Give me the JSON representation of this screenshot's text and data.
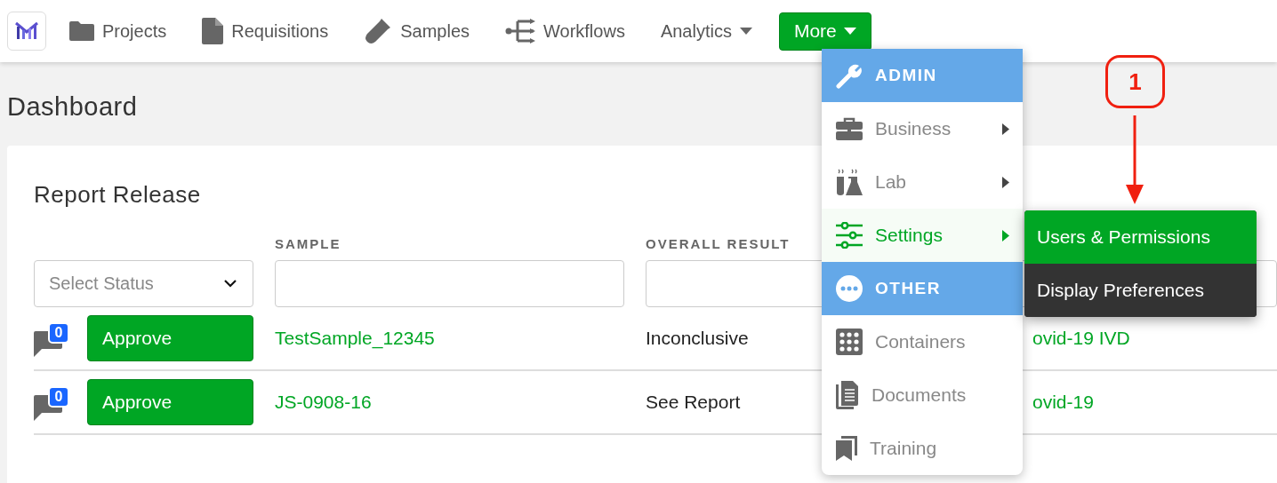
{
  "nav": {
    "items": [
      {
        "label": "Projects",
        "dropdown": false,
        "selected": false
      },
      {
        "label": "Requisitions",
        "dropdown": false,
        "selected": false
      },
      {
        "label": "Samples",
        "dropdown": false,
        "selected": false
      },
      {
        "label": "Workflows",
        "dropdown": false,
        "selected": false
      },
      {
        "label": "Analytics",
        "dropdown": true,
        "selected": false
      },
      {
        "label": "More",
        "dropdown": true,
        "selected": true
      }
    ]
  },
  "page_title": "Dashboard",
  "card": {
    "title": "Report Release",
    "columns": [
      "SAMPLE",
      "OVERALL RESULT"
    ],
    "status_filter": {
      "placeholder": "Select Status"
    },
    "rows": [
      {
        "comments": "0",
        "action": "Approve",
        "sample": "TestSample_12345",
        "result": "Inconclusive",
        "column_5": "ovid-19 IVD"
      },
      {
        "comments": "0",
        "action": "Approve",
        "sample": "JS-0908-16",
        "result": "See Report",
        "column_5": "ovid-19"
      }
    ]
  },
  "menu": {
    "items": [
      {
        "kind": "header",
        "label": "ADMIN"
      },
      {
        "kind": "item",
        "label": "Business",
        "submenu": true,
        "selected": false
      },
      {
        "kind": "item",
        "label": "Lab",
        "submenu": true,
        "selected": false
      },
      {
        "kind": "item",
        "label": "Settings",
        "submenu": true,
        "selected": true
      },
      {
        "kind": "header",
        "label": "OTHER"
      },
      {
        "kind": "item",
        "label": "Containers",
        "submenu": false,
        "selected": false
      },
      {
        "kind": "item",
        "label": "Documents",
        "submenu": false,
        "selected": false
      },
      {
        "kind": "item",
        "label": "Training",
        "submenu": false,
        "selected": false
      }
    ]
  },
  "submenu": {
    "items": [
      {
        "label": "Users & Permissions",
        "selected": true
      },
      {
        "label": "Display Preferences",
        "selected": false
      }
    ]
  },
  "annotation": {
    "label": "1"
  }
}
